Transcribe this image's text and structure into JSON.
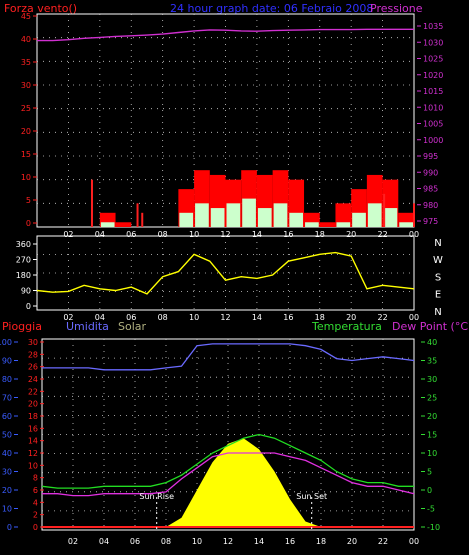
{
  "colors": {
    "wind": "#ff2020",
    "gust": "#ff0000",
    "pressure": "#d030d0",
    "title": "#3030ff",
    "white": "#ffffff",
    "axisBlue": "#3a5cff",
    "direction": "#ffff00",
    "rain": "#ff2020",
    "humidity": "#6a6aff",
    "solar": "#ffff00",
    "temperature": "#22dd22",
    "dewpoint": "#e030e0",
    "sunMarker": "#ffffff",
    "green": "#33dd33",
    "olive": "#b0b080",
    "magenta": "#d030d0"
  },
  "hours": [
    "02",
    "04",
    "06",
    "08",
    "10",
    "12",
    "14",
    "16",
    "18",
    "20",
    "22",
    "00"
  ],
  "chart_data": [
    {
      "type": "line",
      "id": "wind-pressure",
      "title": "24 hour graph date: 06 Febraio 2008",
      "left_label": "Forza vento()",
      "right_label": "Pressione",
      "left_ticks": [
        "45",
        "40",
        "35",
        "30",
        "25",
        "20",
        "15",
        "10",
        "5",
        "0"
      ],
      "right_ticks": [
        "1035",
        "1030",
        "1025",
        "1020",
        "1015",
        "1010",
        "1005",
        "1000",
        "995",
        "990",
        "985",
        "980",
        "975"
      ],
      "ylim": [
        0,
        45
      ],
      "ylim_right": [
        975,
        1035
      ],
      "x_hours": [
        1,
        2,
        3,
        4,
        5,
        6,
        7,
        8,
        9,
        10,
        11,
        12,
        13,
        14,
        15,
        16,
        17,
        18,
        19,
        20,
        21,
        22,
        23,
        24
      ],
      "series": [
        {
          "name": "wind_gust",
          "values": [
            0,
            0,
            0,
            0,
            3,
            1,
            0,
            0,
            0,
            8,
            12,
            11,
            10,
            12,
            11,
            12,
            10,
            3,
            1,
            5,
            8,
            11,
            10,
            3
          ]
        },
        {
          "name": "wind_avg",
          "values": [
            0,
            0,
            0,
            0,
            1,
            0,
            0,
            0,
            0,
            3,
            5,
            4,
            5,
            6,
            4,
            5,
            3,
            1,
            0,
            1,
            3,
            5,
            4,
            1
          ]
        },
        {
          "name": "pressure",
          "values": [
            1030.5,
            1030.8,
            1031.2,
            1031.5,
            1031.8,
            1032.0,
            1032.2,
            1032.5,
            1033.0,
            1033.5,
            1033.8,
            1033.7,
            1033.5,
            1033.4,
            1033.6,
            1033.7,
            1033.8,
            1033.9,
            1033.9,
            1033.9,
            1034.0,
            1034.0,
            1034.0,
            1034.0
          ]
        }
      ],
      "spikes": [
        [
          3.5,
          10
        ],
        [
          6.4,
          5
        ],
        [
          6.7,
          3
        ],
        [
          22.1,
          7
        ],
        [
          24.0,
          5
        ]
      ]
    },
    {
      "type": "line",
      "id": "wind-direction",
      "y_ticks": [
        "360",
        "270",
        "180",
        "90",
        "0"
      ],
      "ylim": [
        0,
        360
      ],
      "compass": [
        "N",
        "W",
        "S",
        "E",
        "N"
      ],
      "x_hours": [
        0,
        1,
        2,
        3,
        4,
        5,
        6,
        7,
        8,
        9,
        10,
        11,
        12,
        13,
        14,
        15,
        16,
        17,
        18,
        19,
        20,
        21,
        22,
        23,
        24
      ],
      "series": [
        {
          "name": "direction",
          "values": [
            90,
            80,
            85,
            120,
            100,
            90,
            110,
            70,
            170,
            200,
            300,
            260,
            150,
            170,
            160,
            180,
            260,
            280,
            300,
            310,
            290,
            100,
            120,
            110,
            100
          ]
        }
      ]
    },
    {
      "type": "line",
      "id": "rain-humidity-temp",
      "labels": {
        "rain": "Pioggia",
        "humidity": "Umidita",
        "solar": "Solar",
        "temperature": "Temperatura",
        "dewpoint": "Dew Point (°C)"
      },
      "left_ticks": [
        "100",
        "90",
        "80",
        "70",
        "60",
        "50",
        "40",
        "30",
        "20",
        "10",
        "0"
      ],
      "mid_ticks": [
        "30",
        "28",
        "26",
        "24",
        "22",
        "20",
        "18",
        "16",
        "14",
        "12",
        "10",
        "8",
        "6",
        "4",
        "2",
        "0"
      ],
      "right_ticks": [
        "40",
        "35",
        "30",
        "25",
        "20",
        "15",
        "10",
        "5",
        "0",
        "-5",
        "-10"
      ],
      "ylim_left": [
        0,
        100
      ],
      "ylim_right": [
        -10,
        40
      ],
      "sun_rise_label": "Sun Rise",
      "sun_set_label": "Sun Set",
      "sun_rise_hour": 7.4,
      "sun_set_hour": 17.4,
      "x_hours": [
        0,
        1,
        2,
        3,
        4,
        5,
        6,
        7,
        8,
        9,
        10,
        11,
        12,
        13,
        14,
        15,
        16,
        17,
        18,
        19,
        20,
        21,
        22,
        23,
        24
      ],
      "series": [
        {
          "name": "humidity",
          "values": [
            86,
            86,
            86,
            86,
            85,
            85,
            85,
            85,
            86,
            87,
            98,
            99,
            99,
            99,
            99,
            99,
            99,
            98,
            96,
            91,
            90,
            91,
            92,
            91,
            90
          ]
        },
        {
          "name": "temperature",
          "values": [
            1,
            0.5,
            0.5,
            0.5,
            1,
            1,
            1,
            1,
            2,
            4,
            7,
            10,
            12,
            14,
            15,
            14,
            12,
            10,
            8,
            5,
            3,
            2,
            2,
            1,
            1
          ]
        },
        {
          "name": "dewpoint",
          "values": [
            -1,
            -1,
            -1.5,
            -1.5,
            -1,
            -1,
            -1,
            -1,
            -0.5,
            3,
            6,
            9,
            10,
            10,
            10,
            10,
            9,
            8,
            6,
            4,
            2,
            1,
            1,
            0,
            -1
          ]
        },
        {
          "name": "solar",
          "values": [
            0,
            0,
            0,
            0,
            0,
            0,
            0,
            0,
            0,
            5,
            20,
            35,
            45,
            48,
            42,
            30,
            15,
            3,
            0,
            0,
            0,
            0,
            0,
            0,
            0
          ]
        }
      ]
    }
  ]
}
